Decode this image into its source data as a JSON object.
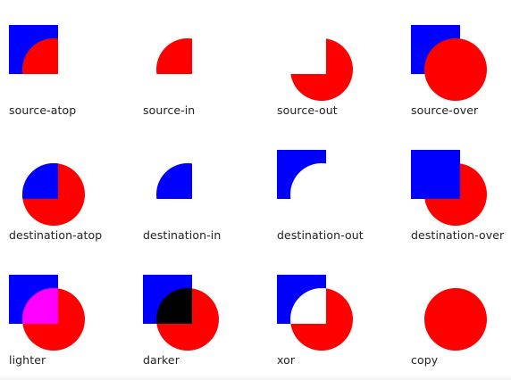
{
  "colors": {
    "destination": "#0000ff",
    "source": "#ff0000",
    "lighter_overlap": "#ff00ff",
    "darker_overlap": "#000000",
    "background": "#ffffff"
  },
  "shapes": {
    "destination": "square",
    "source": "circle"
  },
  "examples": [
    {
      "label": "source-atop",
      "mode": "source-atop"
    },
    {
      "label": "source-in",
      "mode": "source-in"
    },
    {
      "label": "source-out",
      "mode": "source-out"
    },
    {
      "label": "source-over",
      "mode": "source-over"
    },
    {
      "label": "destination-atop",
      "mode": "destination-atop"
    },
    {
      "label": "destination-in",
      "mode": "destination-in"
    },
    {
      "label": "destination-out",
      "mode": "destination-out"
    },
    {
      "label": "destination-over",
      "mode": "destination-over"
    },
    {
      "label": "lighter",
      "mode": "lighter"
    },
    {
      "label": "darker",
      "mode": "darker"
    },
    {
      "label": "xor",
      "mode": "xor"
    },
    {
      "label": "copy",
      "mode": "copy"
    }
  ]
}
